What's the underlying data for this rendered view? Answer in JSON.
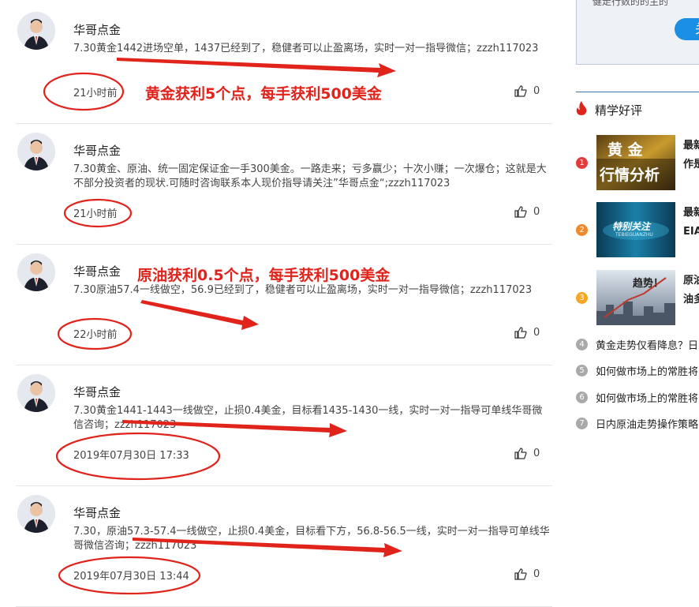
{
  "posts": [
    {
      "author": "华哥点金",
      "text": "7.30黄金1442进场空单，1437已经到了，稳健者可以止盈离场，实时一对一指导微信；zzzh117023",
      "time": "21小时前",
      "likes": "0"
    },
    {
      "author": "华哥点金",
      "text": "7.30黄金、原油、统一固定保证金一手300美金。一路走来；亏多赢少；十次小赚；一次爆仓；这就是大不部分投资者的现状.可随时咨询联系本人现价指导请关注”华哥点金“;zzzh117023",
      "time": "21小时前",
      "likes": "0"
    },
    {
      "author": "华哥点金",
      "text": "7.30原油57.4一线做空，56.9已经到了，稳健者可以止盈离场，实时一对一指导微信；zzzh117023",
      "time": "22小时前",
      "likes": "0"
    },
    {
      "author": "华哥点金",
      "text": "7.30黄金1441-1443一线做空，止损0.4美金，目标看1435-1430一线，实时一对一指导可单线华哥微信咨询；zzzh117023",
      "time": "2019年07月30日 17:33",
      "likes": "0"
    },
    {
      "author": "华哥点金",
      "text": "7.30，原油57.3-57.4一线做空，止损0.4美金，目标看下方，56.8-56.5一线，实时一对一指导可单线华哥微信咨询；zzzh117023",
      "time": "2019年07月30日 13:44",
      "likes": "0"
    }
  ],
  "annotations": {
    "gold_profit": "黄金获利5个点，每手获利500美金",
    "oil_profit": "原油获利0.5个点，每手获利500美金"
  },
  "sidebar": {
    "ad_text": "健走行数的的主的",
    "ad_button": "关",
    "section_title": "精学好评",
    "ranked": [
      {
        "rank": "1",
        "title_lines": [
          "最新",
          "作是"
        ],
        "thumb_text": [
          "黄 金",
          "行情分析"
        ],
        "badge_color": "#e33b3b"
      },
      {
        "rank": "2",
        "title_lines": [
          "最新",
          "EIA"
        ],
        "thumb_text": [
          "特别关注",
          "TEBIEGUANZHU"
        ],
        "badge_color": "#f08a2c"
      },
      {
        "rank": "3",
        "title_lines": [
          "原油",
          "油多"
        ],
        "thumb_text": [
          "趋势！"
        ],
        "badge_color": "#f5a623"
      }
    ],
    "list": [
      {
        "rank": "4",
        "title": "黄金走势仅看降息？日"
      },
      {
        "rank": "5",
        "title": "如何做市场上的常胜将"
      },
      {
        "rank": "6",
        "title": "如何做市场上的常胜将"
      },
      {
        "rank": "7",
        "title": "日内原油走势操作策略"
      }
    ]
  },
  "colors": {
    "accent_red": "#e0231b",
    "link_blue": "#1a8fe3",
    "divider": "#e6e6e6"
  }
}
